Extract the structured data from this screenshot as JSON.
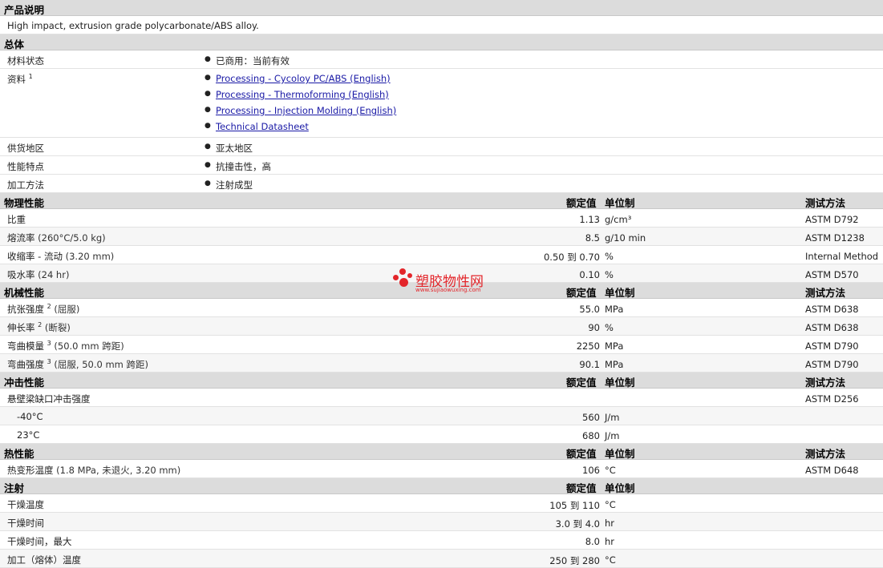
{
  "product_desc": {
    "header": "产品说明",
    "text": "High impact, extrusion grade polycarbonate/ABS alloy."
  },
  "general": {
    "header": "总体",
    "rows": [
      {
        "label": "材料状态",
        "items": [
          "已商用：当前有效"
        ]
      },
      {
        "label": "资料",
        "sup": "1",
        "links": [
          "Processing - Cycoloy PC/ABS (English)",
          "Processing - Thermoforming (English)",
          "Processing - Injection Molding (English)",
          "Technical Datasheet"
        ]
      },
      {
        "label": "供货地区",
        "items": [
          "亚太地区"
        ]
      },
      {
        "label": "性能特点",
        "items": [
          "抗撞击性，高"
        ]
      },
      {
        "label": "加工方法",
        "items": [
          "注射成型"
        ]
      }
    ]
  },
  "columns": {
    "value": "额定值",
    "unit": "单位制",
    "method": "测试方法"
  },
  "sections": [
    {
      "title": "物理性能",
      "show_method": true,
      "rows": [
        {
          "label": "比重",
          "cond": "",
          "value": "1.13",
          "unit": "g/cm³",
          "method": "ASTM D792"
        },
        {
          "label": "熔流率",
          "cond": "(260°C/5.0 kg)",
          "value": "8.5",
          "unit": "g/10 min",
          "method": "ASTM D1238"
        },
        {
          "label": "收缩率 - 流动",
          "cond": "(3.20 mm)",
          "value": "0.50 到  0.70",
          "unit": "%",
          "method": "Internal Method"
        },
        {
          "label": "吸水率",
          "cond": "(24 hr)",
          "value": "0.10",
          "unit": "%",
          "method": "ASTM D570"
        }
      ]
    },
    {
      "title": "机械性能",
      "show_method": true,
      "rows": [
        {
          "label": "抗张强度",
          "sup": "2",
          "cond": "(屈服)",
          "value": "55.0",
          "unit": "MPa",
          "method": "ASTM D638"
        },
        {
          "label": "伸长率",
          "sup": "2",
          "cond": "(断裂)",
          "value": "90",
          "unit": "%",
          "method": "ASTM D638"
        },
        {
          "label": "弯曲模量",
          "sup": "3",
          "cond": "(50.0 mm 跨距)",
          "value": "2250",
          "unit": "MPa",
          "method": "ASTM D790"
        },
        {
          "label": "弯曲强度",
          "sup": "3",
          "cond": "(屈服, 50.0 mm 跨距)",
          "value": "90.1",
          "unit": "MPa",
          "method": "ASTM D790"
        }
      ]
    },
    {
      "title": "冲击性能",
      "show_method": true,
      "rows": [
        {
          "label": "悬壁梁缺口冲击强度",
          "cond": "",
          "value": "",
          "unit": "",
          "method": "ASTM D256"
        },
        {
          "label": "-40°C",
          "sub": true,
          "cond": "",
          "value": "560",
          "unit": "J/m",
          "method": ""
        },
        {
          "label": "23°C",
          "sub": true,
          "cond": "",
          "value": "680",
          "unit": "J/m",
          "method": ""
        }
      ]
    },
    {
      "title": "热性能",
      "show_method": true,
      "rows": [
        {
          "label": "热变形温度",
          "cond": "(1.8 MPa, 未退火, 3.20 mm)",
          "value": "106",
          "unit": "°C",
          "method": "ASTM D648"
        }
      ]
    },
    {
      "title": "注射",
      "show_method": false,
      "rows": [
        {
          "label": "干燥温度",
          "cond": "",
          "value": "105 到  110",
          "unit": "°C",
          "method": ""
        },
        {
          "label": "干燥时间",
          "cond": "",
          "value": "3.0 到  4.0",
          "unit": "hr",
          "method": ""
        },
        {
          "label": "干燥时间，最大",
          "cond": "",
          "value": "8.0",
          "unit": "hr",
          "method": ""
        },
        {
          "label": "加工（熔体）温度",
          "cond": "",
          "value": "250 到  280",
          "unit": "°C",
          "method": ""
        }
      ]
    }
  ],
  "watermark": {
    "name": "塑胶物性网",
    "url": "www.sujiaowuxing.com",
    "color": "#e3252a"
  }
}
